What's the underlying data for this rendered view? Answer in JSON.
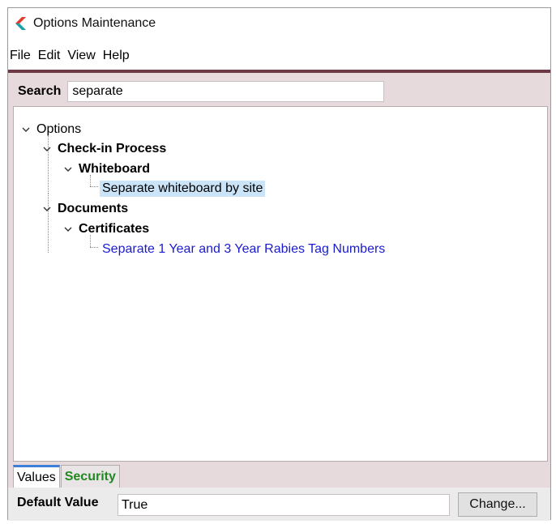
{
  "window": {
    "title": "Options Maintenance"
  },
  "menu": {
    "items": [
      "File",
      "Edit",
      "View",
      "Help"
    ]
  },
  "search": {
    "label": "Search",
    "value": "separate"
  },
  "tree": {
    "root": "Options",
    "nodes": {
      "checkin": "Check-in Process",
      "whiteboard": "Whiteboard",
      "separate_whiteboard": "Separate whiteboard by site",
      "documents": "Documents",
      "certificates": "Certificates",
      "separate_rabies": "Separate 1 Year and 3 Year Rabies Tag Numbers"
    },
    "selected": "Separate whiteboard by site"
  },
  "tabs": [
    {
      "label": "Values",
      "active": true
    },
    {
      "label": "Security",
      "active": false
    }
  ],
  "default_value": {
    "label": "Default Value",
    "value": "True"
  },
  "buttons": {
    "change": "Change..."
  },
  "colors": {
    "accent_bar": "#6b3a44",
    "link": "#1a1ad0",
    "security_tab": "#1f8a1f",
    "selection": "#cce4f7"
  },
  "icons": {
    "app": "app-logo-icon",
    "expand": "chevron-down-icon"
  }
}
